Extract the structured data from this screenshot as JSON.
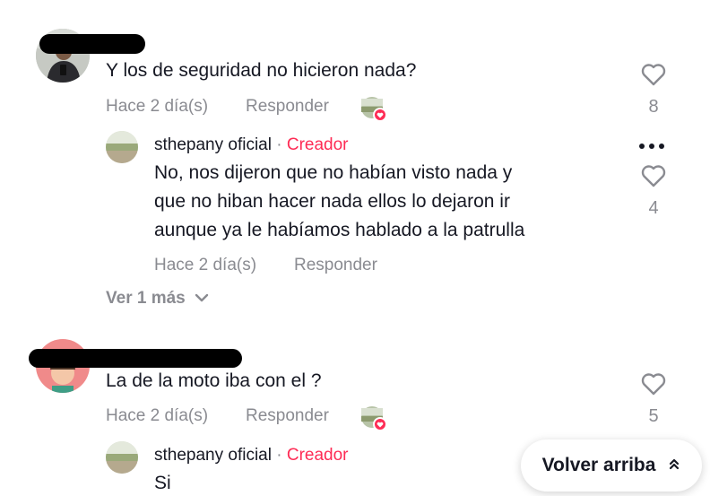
{
  "comments": [
    {
      "text": "Y los de seguridad no hicieron nada?",
      "time": "Hace 2 día(s)",
      "reply_label": "Responder",
      "likes": "8"
    },
    {
      "text": "La de la moto iba con el ?",
      "time": "Hace 2 día(s)",
      "reply_label": "Responder",
      "likes": "5"
    }
  ],
  "replies": [
    {
      "username": "sthepany oficial",
      "separator": "·",
      "badge": "Creador",
      "lines": [
        "No, nos dijeron que no habían visto nada y",
        "que no hiban hacer nada ellos lo dejaron ir",
        "aunque ya le habíamos hablado a la patrulla"
      ],
      "time": "Hace 2 día(s)",
      "reply_label": "Responder",
      "likes": "4"
    },
    {
      "username": "sthepany oficial",
      "separator": "·",
      "badge": "Creador",
      "lines": [
        "Si"
      ]
    }
  ],
  "view_more": "Ver 1 más",
  "back_to_top": "Volver arriba",
  "colors": {
    "creator": "#fe2c55",
    "muted": "#8a8b91",
    "text": "#161823"
  },
  "icons": [
    "heart-icon",
    "more-icon",
    "chevron-down-icon",
    "double-chevron-up-icon",
    "creator-liked-badge-icon"
  ]
}
